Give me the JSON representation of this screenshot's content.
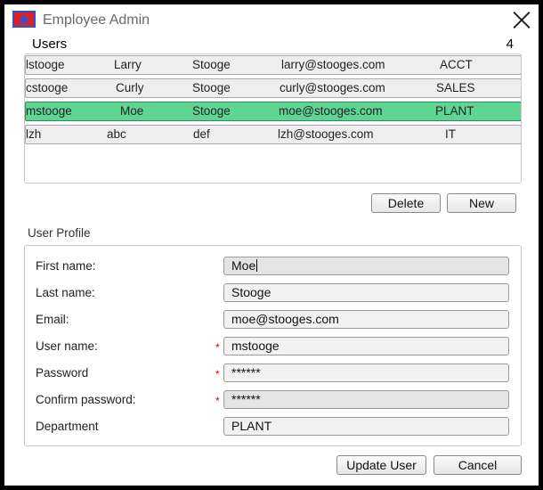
{
  "window": {
    "title": "Employee Admin"
  },
  "users": {
    "label": "Users",
    "count": "4",
    "rows": [
      {
        "username": "lstooge",
        "first": "Larry",
        "last": "Stooge",
        "email": "larry@stooges.com",
        "dept": "ACCT"
      },
      {
        "username": "cstooge",
        "first": "Curly",
        "last": "Stooge",
        "email": "curly@stooges.com",
        "dept": "SALES"
      },
      {
        "username": "mstooge",
        "first": "Moe",
        "last": "Stooge",
        "email": "moe@stooges.com",
        "dept": "PLANT"
      },
      {
        "username": "lzh",
        "first": "abc",
        "last": "def",
        "email": "lzh@stooges.com",
        "dept": "IT"
      }
    ],
    "selected_index": 2
  },
  "list_buttons": {
    "delete": "Delete",
    "new": "New"
  },
  "profile": {
    "title": "User Profile",
    "first_name": {
      "label": "First name:",
      "value": "Moe"
    },
    "last_name": {
      "label": "Last name:",
      "value": "Stooge"
    },
    "email": {
      "label": "Email:",
      "value": "moe@stooges.com"
    },
    "username": {
      "label": "User name:",
      "value": "mstooge",
      "required": "*"
    },
    "password": {
      "label": "Password",
      "value": "******",
      "required": "*"
    },
    "confirm_password": {
      "label": "Confirm password:",
      "value": "******",
      "required": "*"
    },
    "department": {
      "label": "Department",
      "value": "PLANT"
    }
  },
  "footer_buttons": {
    "update": "Update User",
    "cancel": "Cancel"
  },
  "colors": {
    "selected_row": "#5fd593",
    "required": "#dd0000",
    "logo_red": "#e02020",
    "logo_blue": "#3050d0"
  },
  "icons": {
    "app": "app-logo-icon",
    "close": "close-icon"
  }
}
